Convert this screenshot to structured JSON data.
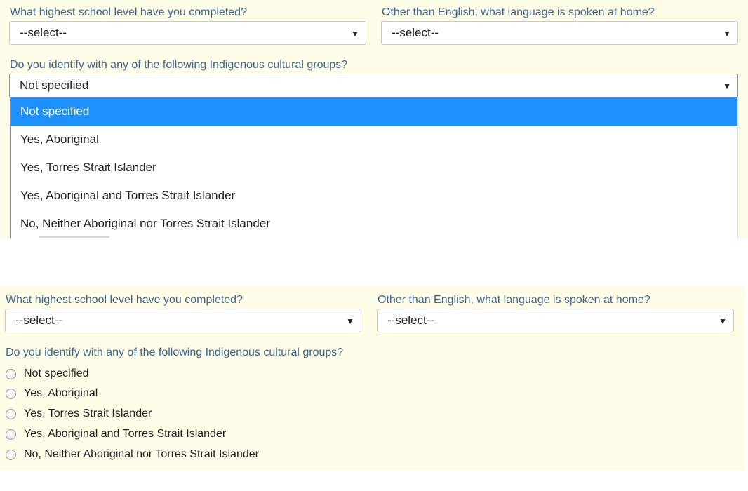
{
  "top": {
    "school_label": "What highest school level have you completed?",
    "school_value": "--select--",
    "language_label": "Other than English, what language is spoken at home?",
    "language_value": "--select--",
    "indigenous_label": "Do you identify with any of the following Indigenous cultural groups?",
    "indigenous_value": "Not specified",
    "dropdown_options": [
      "Not specified",
      "Yes, Aboriginal",
      "Yes, Torres Strait Islander",
      "Yes, Aboriginal and Torres Strait Islander",
      "No, Neither Aboriginal nor Torres Strait Islander"
    ],
    "selected_option": "Not specified"
  },
  "bottom": {
    "school_label": "What highest school level have you completed?",
    "school_value": "--select--",
    "language_label": "Other than English, what language is spoken at home?",
    "language_value": "--select--",
    "indigenous_label": "Do you identify with any of the following Indigenous cultural groups?",
    "radio_options": [
      "Not specified",
      "Yes, Aboriginal",
      "Yes, Torres Strait Islander",
      "Yes, Aboriginal and Torres Strait Islander",
      "No, Neither Aboriginal nor Torres Strait Islander"
    ]
  },
  "icons": {
    "dropdown_arrow": "▼"
  },
  "colors": {
    "label": "#3f6590",
    "panel_bg": "#fdfde8",
    "selected_option_bg": "#1e90ff"
  }
}
